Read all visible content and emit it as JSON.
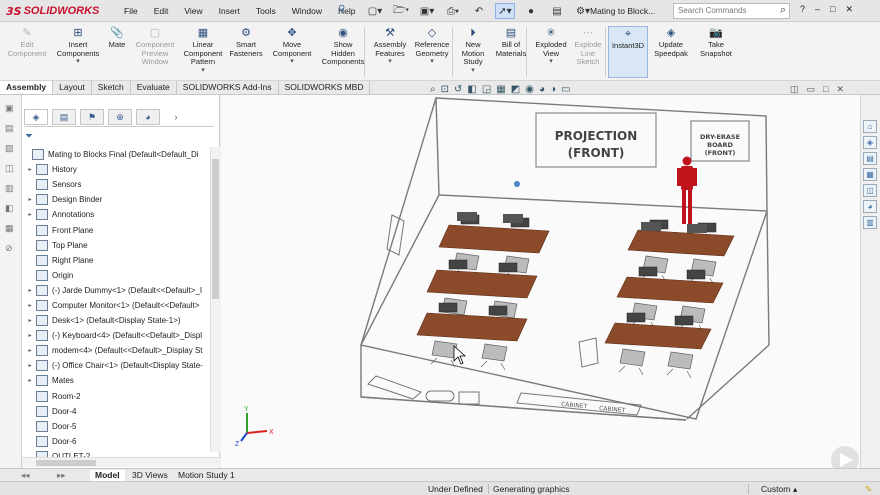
{
  "brand": {
    "ds": "3S",
    "name": "SOLIDWORKS"
  },
  "menu": [
    "File",
    "Edit",
    "View",
    "Insert",
    "Tools",
    "Window",
    "Help"
  ],
  "quick_access": [
    "new-icon",
    "open-icon",
    "save-icon",
    "print-icon",
    "undo-icon",
    "select-icon",
    "rebuild-icon",
    "options-icon"
  ],
  "doc_title": "Mating to Block...",
  "search": {
    "placeholder": "Search Commands"
  },
  "window_controls": [
    "?",
    "–",
    "□",
    "✕"
  ],
  "commands": [
    {
      "id": "edit-component",
      "label": "Edit\nComponent",
      "disabled": true
    },
    {
      "id": "insert-components",
      "label": "Insert\nComponents",
      "disabled": false
    },
    {
      "id": "mate",
      "label": "Mate",
      "disabled": false
    },
    {
      "id": "component-preview-window",
      "label": "Component\nPreview\nWindow",
      "disabled": true
    },
    {
      "id": "linear-component-pattern",
      "label": "Linear\nComponent\nPattern",
      "disabled": false
    },
    {
      "id": "smart-fasteners",
      "label": "Smart\nFasteners",
      "disabled": false
    },
    {
      "id": "move-component",
      "label": "Move\nComponent",
      "disabled": false
    },
    {
      "id": "show-hidden-components",
      "label": "Show\nHidden\nComponents",
      "disabled": false
    },
    {
      "id": "assembly-features",
      "label": "Assembly\nFeatures",
      "disabled": false
    },
    {
      "id": "reference-geometry",
      "label": "Reference\nGeometry",
      "disabled": false
    },
    {
      "id": "new-motion-study",
      "label": "New\nMotion\nStudy",
      "disabled": false
    },
    {
      "id": "bill-of-materials",
      "label": "Bill of\nMaterials",
      "disabled": false
    },
    {
      "id": "exploded-view",
      "label": "Exploded\nView",
      "disabled": false
    },
    {
      "id": "explode-line-sketch",
      "label": "Explode\nLine\nSketch",
      "disabled": true
    },
    {
      "id": "instant3d",
      "label": "Instant3D",
      "disabled": false,
      "active": true
    },
    {
      "id": "update-speedpak",
      "label": "Update\nSpeedpak",
      "disabled": false
    },
    {
      "id": "take-snapshot",
      "label": "Take\nSnapshot",
      "disabled": false
    }
  ],
  "tabs": [
    "Assembly",
    "Layout",
    "Sketch",
    "Evaluate",
    "SOLIDWORKS Add-Ins",
    "SOLIDWORKS MBD"
  ],
  "active_tab": "Assembly",
  "tree": [
    {
      "label": "Mating to Blocks Final  (Default<Default_Di",
      "arrow": false,
      "indent": 0
    },
    {
      "label": "History",
      "arrow": true,
      "indent": 1
    },
    {
      "label": "Sensors",
      "arrow": false,
      "indent": 1
    },
    {
      "label": "Design Binder",
      "arrow": true,
      "indent": 1
    },
    {
      "label": "Annotations",
      "arrow": true,
      "indent": 1
    },
    {
      "label": "Front Plane",
      "arrow": false,
      "indent": 1
    },
    {
      "label": "Top Plane",
      "arrow": false,
      "indent": 1
    },
    {
      "label": "Right Plane",
      "arrow": false,
      "indent": 1
    },
    {
      "label": "Origin",
      "arrow": false,
      "indent": 1
    },
    {
      "label": "(-) Jarde Dummy<1> (Default<<Default>_I",
      "arrow": true,
      "indent": 1
    },
    {
      "label": "Computer Monitor<1> (Default<<Default>",
      "arrow": true,
      "indent": 1
    },
    {
      "label": "Desk<1> (Default<Display State-1>)",
      "arrow": true,
      "indent": 1
    },
    {
      "label": "(-) Keyboard<4> (Default<<Default>_Displ",
      "arrow": true,
      "indent": 1
    },
    {
      "label": "modem<4> (Default<<Default>_Display St",
      "arrow": true,
      "indent": 1
    },
    {
      "label": "(-) Office Chair<1> (Default<Display State-",
      "arrow": true,
      "indent": 1
    },
    {
      "label": "Mates",
      "arrow": true,
      "indent": 1
    },
    {
      "label": "Room-2",
      "arrow": false,
      "indent": 1
    },
    {
      "label": "Door-4",
      "arrow": false,
      "indent": 1
    },
    {
      "label": "Door-5",
      "arrow": false,
      "indent": 1
    },
    {
      "label": "Door-6",
      "arrow": false,
      "indent": 1
    },
    {
      "label": "OUTLET-2",
      "arrow": false,
      "indent": 1
    }
  ],
  "viewport": {
    "board1": "PROJECTION\n(FRONT)",
    "board2": "DRY-ERASE\nBOARD\n(FRONT)",
    "floor_labels": [
      "CABINET",
      "CABINET"
    ],
    "axes": [
      "Y",
      "X",
      "Z"
    ]
  },
  "bottom_tabs": [
    "Model",
    "3D Views",
    "Motion Study 1"
  ],
  "status": {
    "state": "Under Defined",
    "message": "Generating graphics",
    "units": "Custom"
  },
  "colors": {
    "accent": "#c8102e",
    "desk": "#8b4a2a",
    "dummy": "#c0141c",
    "wire": "#606060"
  }
}
